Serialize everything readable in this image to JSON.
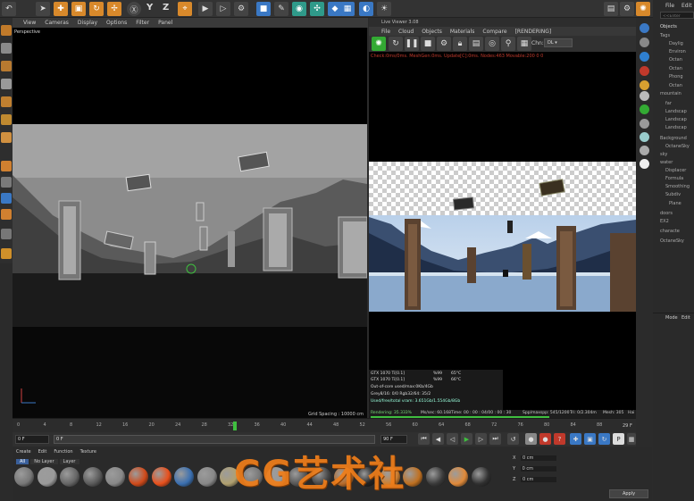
{
  "toolbar": {
    "axis_letters": [
      "X",
      "Y",
      "Z"
    ],
    "right_menu": [
      "File",
      "Edit"
    ]
  },
  "viewport": {
    "menu": [
      "View",
      "Cameras",
      "Display",
      "Options",
      "Filter",
      "Panel"
    ],
    "label": "Perspective",
    "grid_spacing": "Grid Spacing : 10000 cm"
  },
  "live_viewer": {
    "title": "Live Viewer 3.08",
    "menu": [
      "File",
      "Cloud",
      "Objects",
      "Materials",
      "Compare",
      "[RENDERING]"
    ],
    "channel_label": "Chn:",
    "channel_value": "DL",
    "status_line": "Check:0ms/0ms. MeshGen:0ms. Update[C]:0ms. Nodes:463 Movable:200  0 0",
    "gpu_rows": [
      {
        "name": "GTX 1070 Ti[0.1]",
        "pct": "%99",
        "temp": "65°C"
      },
      {
        "name": "GTX 1070 Ti[0.1]",
        "pct": "%99",
        "temp": "66°C"
      }
    ],
    "info_rows": [
      "Out-of-core used/max:0Kb/4Gb",
      "Grey8/16: 0/0          Rgb32/64: 35/2",
      "Used/free/total vram: 3.651Gb/1.554Gb/8Gb"
    ],
    "status": {
      "rendering": "Rendering: 35.333%",
      "mssec": "Ms/sec: 60.168",
      "time": "Time: 00 : 00 : 04/00 : 00 : 30",
      "spp": "Spp/maxspp: 545/1200",
      "tri": "Tri: 0/2.304m",
      "mesh": "Mesh: 305",
      "hair": "Hai"
    }
  },
  "objects_panel": {
    "header": "Objects",
    "search_placeholder": "<<Enter",
    "rows": [
      "Tags",
      "Daylig",
      "Environ",
      "Octan",
      "Octan",
      "Phong",
      "Octan",
      "mountain",
      "far",
      "Landscap",
      "Landscap",
      "Landscap",
      "Background",
      "OctaneSky",
      "sky",
      "water",
      "Displacer",
      "Formula",
      "Smoothing",
      "Subdiv",
      "Plane",
      "doors",
      "EX2",
      "characte",
      "OctaneSky"
    ],
    "attr_header": "Mode",
    "attr_second": "Edit"
  },
  "timeline": {
    "ticks": [
      "0",
      "4",
      "8",
      "12",
      "16",
      "20",
      "24",
      "28",
      "32",
      "36",
      "40",
      "44",
      "48",
      "52",
      "56",
      "60",
      "64",
      "68",
      "72",
      "76",
      "80",
      "84",
      "88"
    ],
    "current_frame": "29",
    "end_frame": "29 F"
  },
  "transport": {
    "start": "0 F",
    "field2": "0 F",
    "end": "90 F",
    "end2": "90 F"
  },
  "materials": {
    "menu": [
      "Create",
      "Edit",
      "Function",
      "Texture"
    ],
    "filters": [
      "All",
      "No Layer",
      "Layer"
    ],
    "swatch_colors": [
      "#777",
      "#9a9a9a",
      "#666",
      "#5a5a5a",
      "#888",
      "#d04a1a",
      "#e8501c",
      "#3a6fb0",
      "#888",
      "#b0a070",
      "#777",
      "#999",
      "#555",
      "#444",
      "#b76b2a",
      "#222",
      "#d08030",
      "#c07020",
      "#3a3a3a",
      "#e08a3a",
      "#303030"
    ]
  },
  "coords": {
    "labels": [
      "X",
      "Y",
      "Z"
    ],
    "values": [
      "0 cm",
      "0 cm",
      "0 cm"
    ],
    "apply": "Apply"
  },
  "watermark": "CG艺术社",
  "colors": {
    "accent_orange": "#d8892b",
    "accent_blue": "#3a78c4",
    "render_green": "#3fbf3f",
    "status_red": "#c0392b"
  }
}
